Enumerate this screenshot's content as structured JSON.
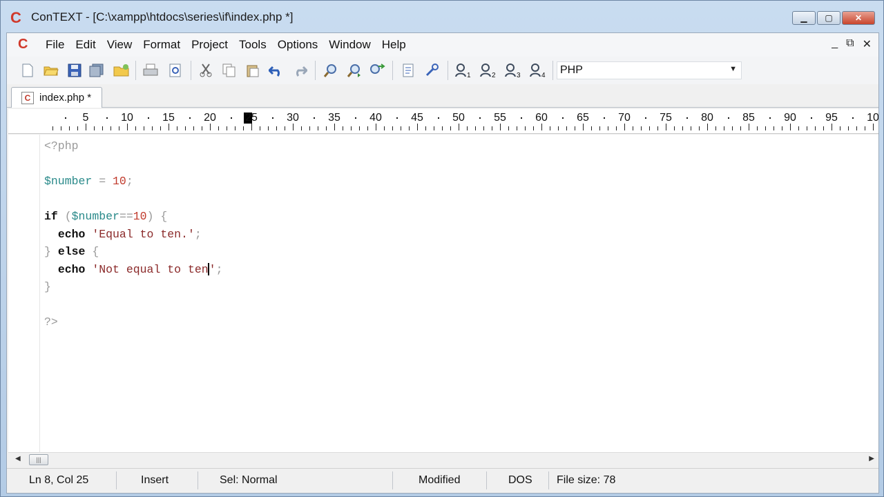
{
  "window": {
    "title": "ConTEXT - [C:\\xampp\\htdocs\\series\\if\\index.php *]",
    "controls": {
      "minimize": "▁",
      "maximize": "▢",
      "close": "✕"
    }
  },
  "menu": {
    "items": [
      "File",
      "Edit",
      "View",
      "Format",
      "Project",
      "Tools",
      "Options",
      "Window",
      "Help"
    ],
    "mdi": {
      "minimize": "_",
      "restore": "⧉",
      "close": "✕"
    }
  },
  "toolbar": {
    "icons": [
      "new-file-icon",
      "open-folder-icon",
      "save-icon",
      "save-all-icon",
      "open-project-icon",
      "print-icon",
      "print-preview-icon",
      "cut-icon",
      "copy-icon",
      "paste-icon",
      "undo-icon",
      "redo-icon",
      "find-icon",
      "find-next-icon",
      "replace-icon",
      "export-icon",
      "tools-icon",
      "user-command-1-icon",
      "user-command-2-icon",
      "user-command-3-icon",
      "user-command-4-icon"
    ],
    "syntax_highlighter": "PHP"
  },
  "tabs": [
    {
      "label": "index.php *"
    }
  ],
  "ruler": {
    "labels": [
      "5",
      "10",
      "15",
      "20",
      "25",
      "30",
      "35",
      "40",
      "45",
      "50",
      "55",
      "60",
      "65",
      "70",
      "75",
      "80",
      "85",
      "90",
      "95",
      "10"
    ]
  },
  "editor": {
    "lines": [
      "<?php",
      "",
      "$number = 10;",
      "",
      "if ($number==10) {",
      "  echo 'Equal to ten.';",
      "} else {",
      "  echo 'Not equal to ten';",
      "}",
      "",
      "?>"
    ],
    "caret": {
      "line": 8,
      "col": 25
    }
  },
  "statusbar": {
    "position": "Ln 8, Col 25",
    "mode": "Insert",
    "selection": "Sel: Normal",
    "modified": "Modified",
    "line_endings": "DOS",
    "file_size": "File size: 78"
  },
  "colors": {
    "keyword": "#111111",
    "variable": "#2a8a8a",
    "number": "#c0392b",
    "string": "#8b2a2a",
    "symbol": "#999999",
    "app_logo": "#d0392b"
  }
}
